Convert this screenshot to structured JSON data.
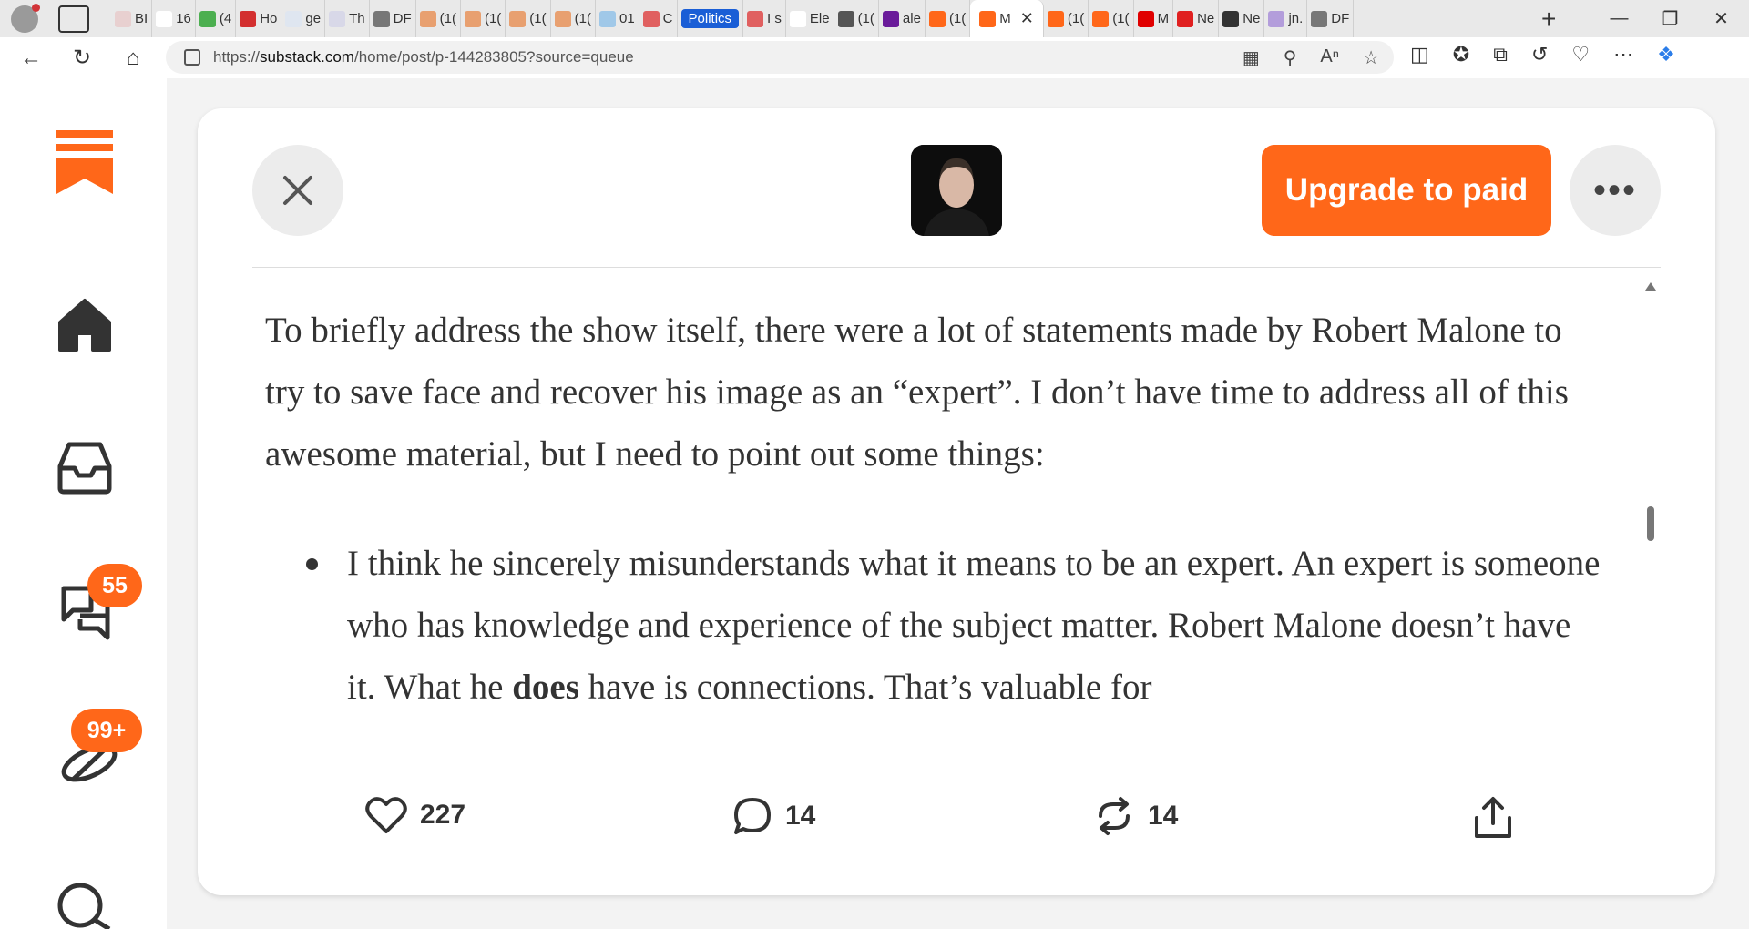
{
  "browser": {
    "tabs": [
      {
        "label": "BI",
        "color": "#e8d0d0"
      },
      {
        "label": "16",
        "color": "#ffffff"
      },
      {
        "label": "(4",
        "color": "#4caf50"
      },
      {
        "label": "Ho",
        "color": "#d32f2f"
      },
      {
        "label": "ge",
        "color": "#dfe6f0"
      },
      {
        "label": "Th",
        "color": "#d8d8e8"
      },
      {
        "label": "DF",
        "color": "#777777"
      },
      {
        "label": "(1(",
        "color": "#e8a070"
      },
      {
        "label": "(1(",
        "color": "#e8a070"
      },
      {
        "label": "(1(",
        "color": "#e8a070"
      },
      {
        "label": "(1(",
        "color": "#e8a070"
      },
      {
        "label": "01",
        "color": "#a0c8e8"
      },
      {
        "label": "C",
        "color": "#e06060"
      },
      {
        "label": "Politics",
        "color": "#1a5ed6",
        "special": "politics"
      },
      {
        "label": "I s",
        "color": "#e06060"
      },
      {
        "label": "Ele",
        "color": "#ffffff"
      },
      {
        "label": "(1(",
        "color": "#555555"
      },
      {
        "label": "ale",
        "color": "#6a1b9a"
      },
      {
        "label": "(1(",
        "color": "#ff6719"
      },
      {
        "label": "M",
        "color": "#ff6719",
        "active": true
      },
      {
        "label": "(1(",
        "color": "#ff6719"
      },
      {
        "label": "(1(",
        "color": "#ff6719"
      },
      {
        "label": "M",
        "color": "#e00000"
      },
      {
        "label": "Ne",
        "color": "#e02020"
      },
      {
        "label": "Ne",
        "color": "#333333"
      },
      {
        "label": "jn.",
        "color": "#b39ddb"
      },
      {
        "label": "DF",
        "color": "#777777"
      }
    ],
    "url_prefix": "https://",
    "url_host": "substack.com",
    "url_path": "/home/post/p-144283805?source=queue"
  },
  "rail": {
    "chat_badge": "55",
    "activity_badge": "99+"
  },
  "post": {
    "upgrade_label": "Upgrade to paid",
    "paragraph": "To briefly address the show itself, there were a lot of statements made by Robert Malone to try to save face and recover his image as an “expert”. I don’t have time to address all of this awesome material, but I need to point out some things:",
    "bullet_pre": "I think he sincerely misunderstands what it means to be an expert. An expert is someone who has knowledge and experience of the subject matter. Robert Malone doesn’t have it. What he ",
    "bullet_bold": "does",
    "bullet_post": " have is connections. That’s valuable for"
  },
  "actions": {
    "likes": "227",
    "comments": "14",
    "restacks": "14"
  },
  "colors": {
    "brand": "#ff6719"
  }
}
